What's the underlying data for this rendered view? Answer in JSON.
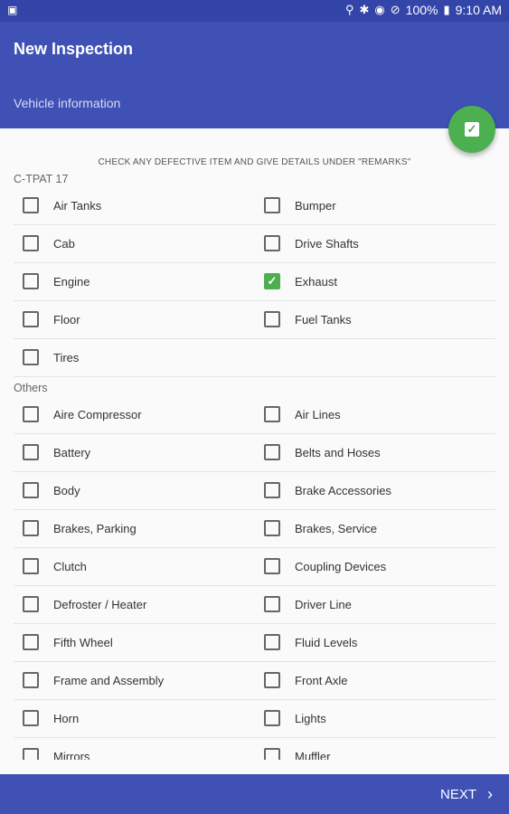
{
  "statusbar": {
    "battery": "100%",
    "time": "9:10 AM"
  },
  "appbar": {
    "title": "New Inspection",
    "subtitle": "Vehicle information"
  },
  "instructions": "CHECK ANY DEFECTIVE ITEM AND GIVE DETAILS UNDER \"REMARKS\"",
  "sections": {
    "ctpat": {
      "label": "C-TPAT 17"
    },
    "others": {
      "label": "Others"
    }
  },
  "items": {
    "air_tanks": "Air Tanks",
    "bumper": "Bumper",
    "cab": "Cab",
    "drive_shafts": "Drive Shafts",
    "engine": "Engine",
    "exhaust": "Exhaust",
    "floor": "Floor",
    "fuel_tanks": "Fuel Tanks",
    "tires": "Tires",
    "aire_compressor": "Aire Compressor",
    "air_lines": "Air Lines",
    "battery": "Battery",
    "belts_hoses": "Belts and Hoses",
    "body": "Body",
    "brake_accessories": "Brake Accessories",
    "brakes_parking": "Brakes, Parking",
    "brakes_service": "Brakes, Service",
    "clutch": "Clutch",
    "coupling_devices": "Coupling Devices",
    "defroster_heater": "Defroster / Heater",
    "driver_line": "Driver Line",
    "fifth_wheel": "Fifth Wheel",
    "fluid_levels": "Fluid Levels",
    "frame_assembly": "Frame and Assembly",
    "front_axle": "Front Axle",
    "horn": "Horn",
    "lights": "Lights",
    "mirrors": "Mirrors",
    "muffler": "Muffler"
  },
  "checked": [
    "exhaust"
  ],
  "bottombar": {
    "next_label": "NEXT"
  }
}
